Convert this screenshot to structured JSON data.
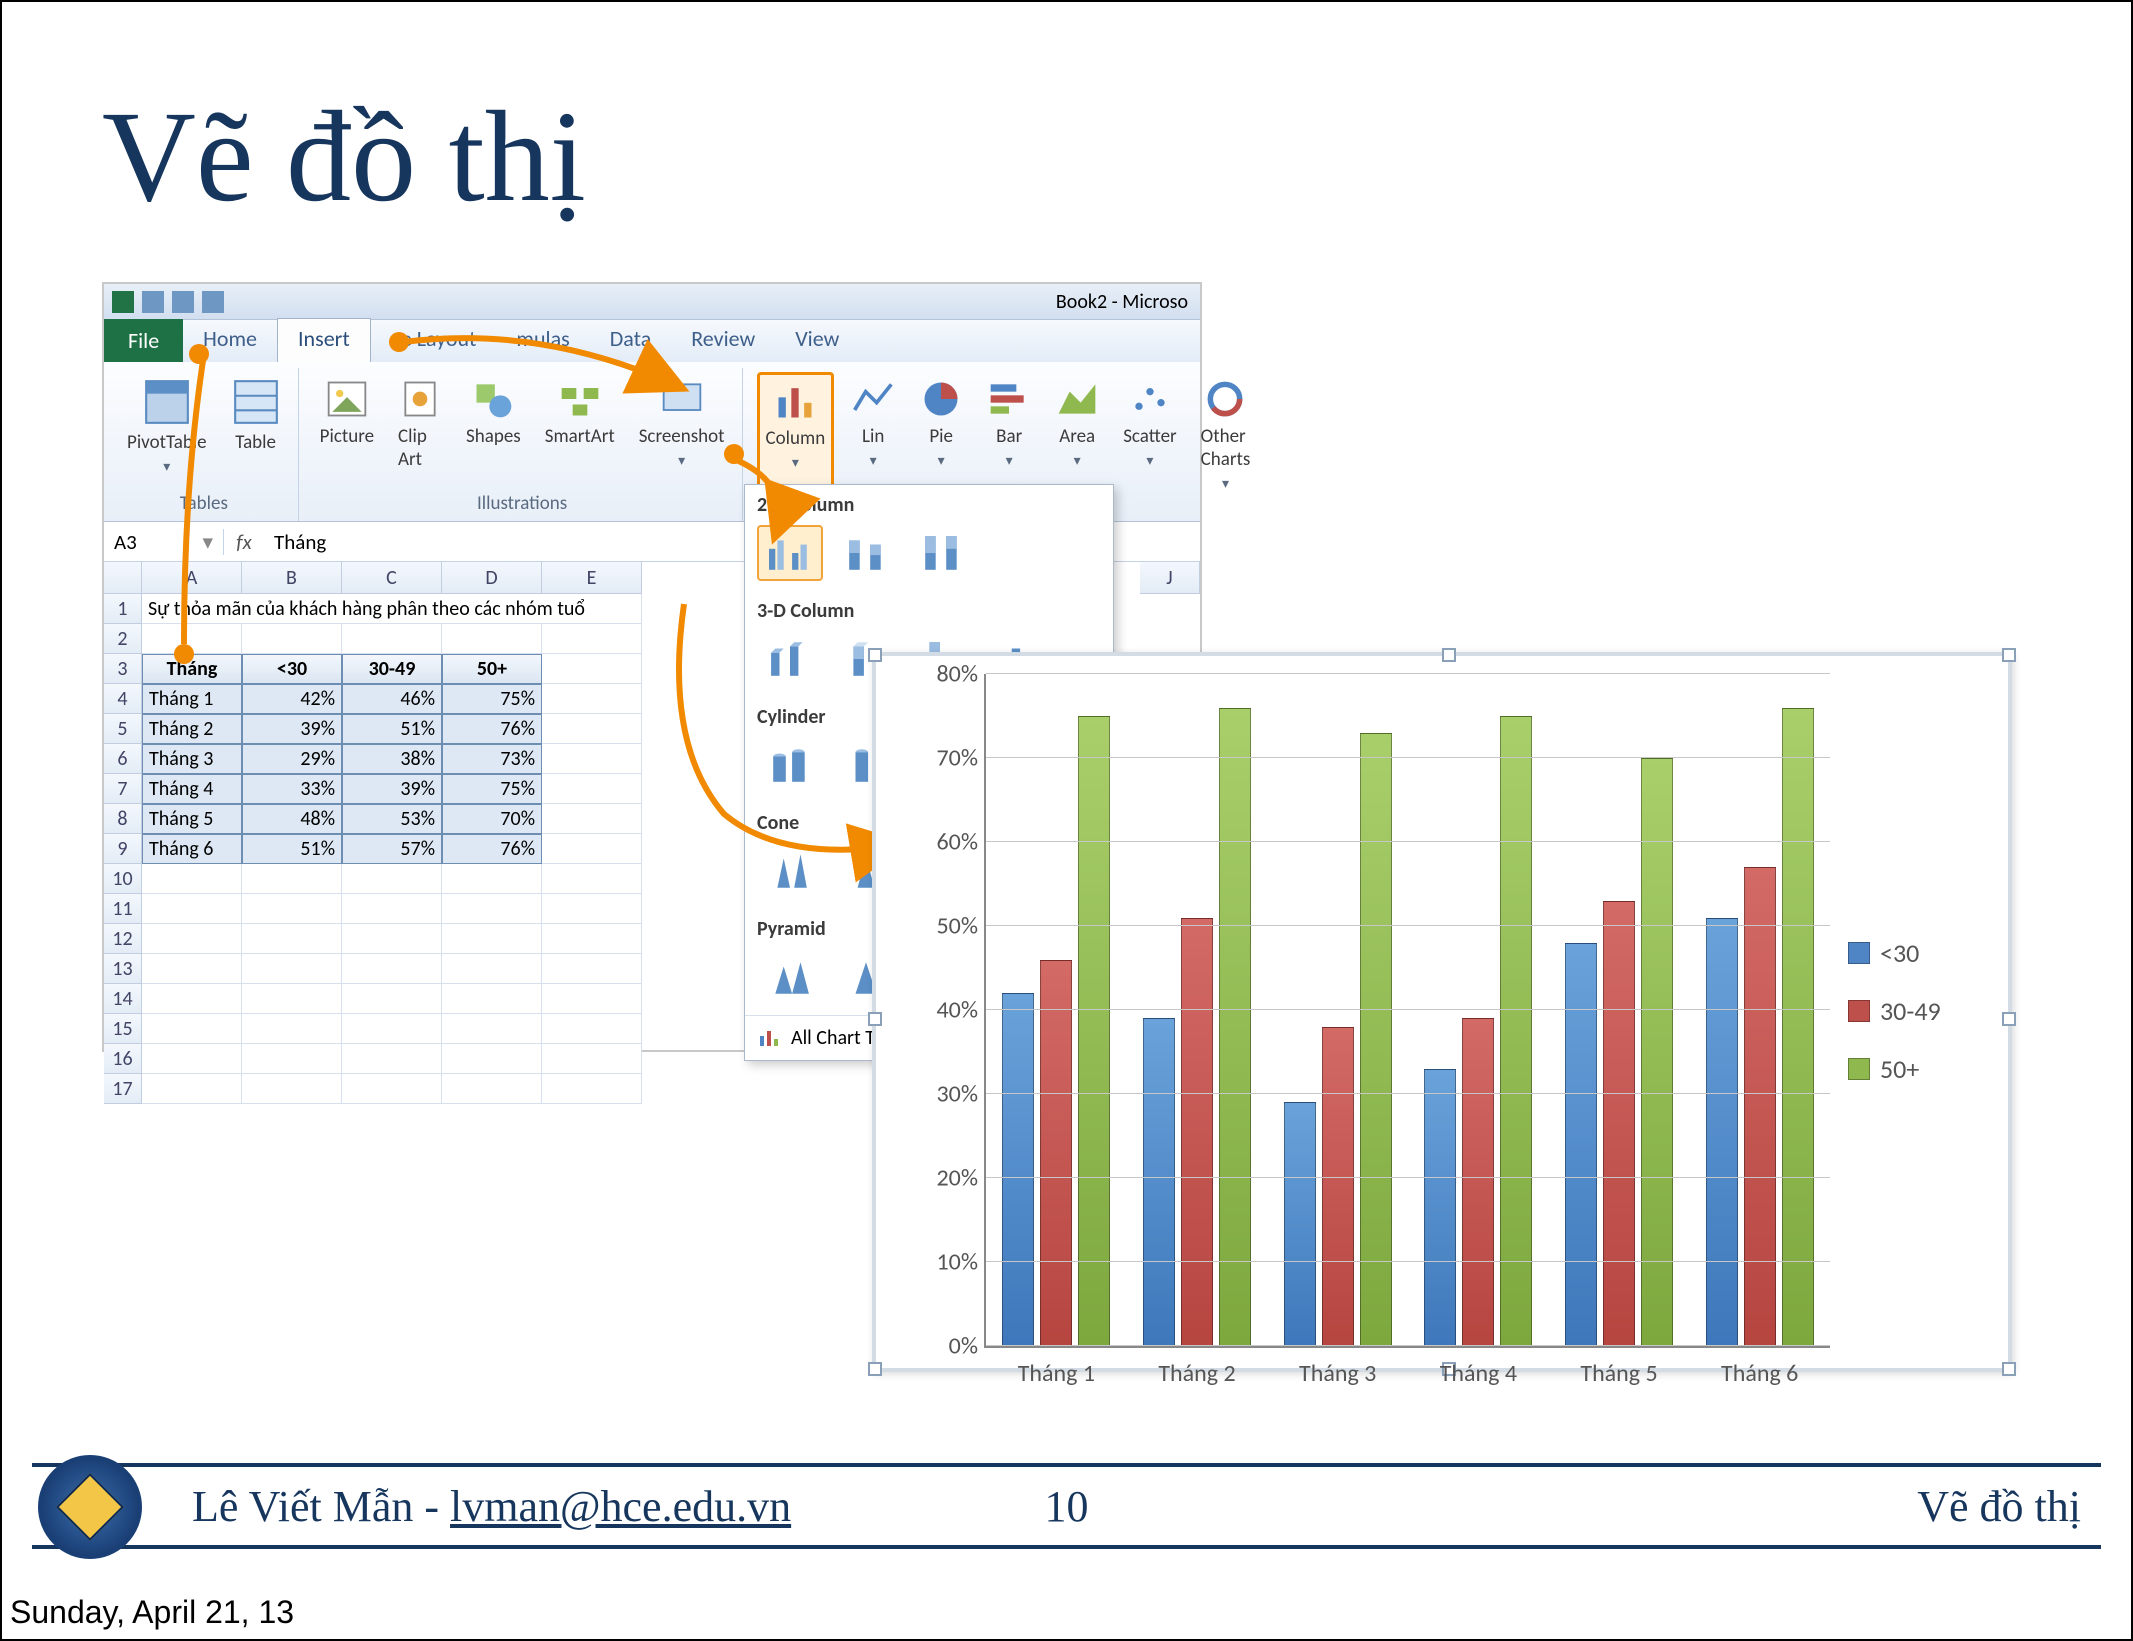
{
  "slide": {
    "title": "Vẽ đồ thị"
  },
  "footer": {
    "author_name": "Lê Viết Mẫn - ",
    "author_email": "lvman@hce.edu.vn",
    "page_number": "10",
    "section_title": "Vẽ đồ thị"
  },
  "datestamp": "Sunday, April 21, 13",
  "excel": {
    "window_title": "Book2 - Microso",
    "tabs": {
      "file": "File",
      "home": "Home",
      "insert": "Insert",
      "page_layout": "ge Layout",
      "formulas": "mulas",
      "data": "Data",
      "review": "Review",
      "view": "View"
    },
    "groups": {
      "tables": "Tables",
      "illustrations": "Illustrations"
    },
    "buttons": {
      "pivottable": "PivotTable",
      "table": "Table",
      "picture": "Picture",
      "clipart": "Clip Art",
      "shapes": "Shapes",
      "smartart": "SmartArt",
      "screenshot": "Screenshot",
      "column": "Column",
      "line": "Lin",
      "pie": "Pie",
      "bar": "Bar",
      "area": "Area",
      "scatter": "Scatter",
      "other": "Other Charts"
    },
    "namebox": "A3",
    "formula_value": "Tháng",
    "dropdown": {
      "sec_2d": "2-D Column",
      "sec_3d": "3-D Column",
      "sec_cylinder": "Cylinder",
      "sec_cone": "Cone",
      "sec_pyramid": "Pyramid",
      "all_types": "All Chart Types..."
    },
    "columns": [
      "A",
      "B",
      "C",
      "D",
      "E",
      "J"
    ],
    "rows_numbers": [
      "1",
      "2",
      "3",
      "4",
      "5",
      "6",
      "7",
      "8",
      "9",
      "10",
      "11",
      "12",
      "13",
      "14",
      "15",
      "16",
      "17"
    ],
    "title_cell": "Sự thỏa mãn của khách hàng phân theo các nhóm tuổ",
    "headers": [
      "Tháng",
      "<30",
      "30-49",
      "50+"
    ],
    "data_rows": [
      [
        "Tháng 1",
        "42%",
        "46%",
        "75%"
      ],
      [
        "Tháng 2",
        "39%",
        "51%",
        "76%"
      ],
      [
        "Tháng 3",
        "29%",
        "38%",
        "73%"
      ],
      [
        "Tháng 4",
        "33%",
        "39%",
        "75%"
      ],
      [
        "Tháng 5",
        "48%",
        "53%",
        "70%"
      ],
      [
        "Tháng 6",
        "51%",
        "57%",
        "76%"
      ]
    ]
  },
  "chart_data": {
    "type": "bar",
    "categories": [
      "Tháng 1",
      "Tháng 2",
      "Tháng 3",
      "Tháng 4",
      "Tháng 5",
      "Tháng 6"
    ],
    "series": [
      {
        "name": "<30",
        "values": [
          42,
          39,
          29,
          33,
          48,
          51
        ]
      },
      {
        "name": "30-49",
        "values": [
          46,
          51,
          38,
          39,
          53,
          57
        ]
      },
      {
        "name": "50+",
        "values": [
          75,
          76,
          73,
          75,
          70,
          76
        ]
      }
    ],
    "y_ticks": [
      "0%",
      "10%",
      "20%",
      "30%",
      "40%",
      "50%",
      "60%",
      "70%",
      "80%"
    ],
    "ylim": [
      0,
      80
    ],
    "xlabel": "",
    "ylabel": "",
    "title": ""
  }
}
